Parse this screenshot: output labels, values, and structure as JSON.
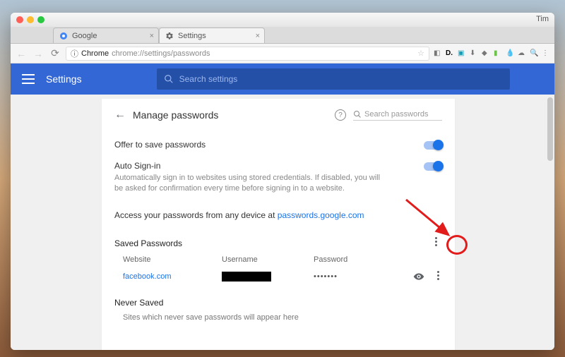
{
  "os": {
    "user": "Tim"
  },
  "browser": {
    "tabs": [
      {
        "title": "Google",
        "active": false
      },
      {
        "title": "Settings",
        "active": true
      }
    ],
    "address": {
      "scheme_label": "Chrome",
      "path": "chrome://settings/passwords"
    }
  },
  "header": {
    "app_title": "Settings",
    "search_placeholder": "Search settings"
  },
  "page": {
    "title": "Manage passwords",
    "search_placeholder": "Search passwords",
    "offer": {
      "title": "Offer to save passwords",
      "enabled": true
    },
    "autosignin": {
      "title": "Auto Sign-in",
      "description": "Automatically sign in to websites using stored credentials. If disabled, you will be asked for confirmation every time before signing in to a website.",
      "enabled": true
    },
    "access_line_prefix": "Access your passwords from any device at ",
    "access_link": "passwords.google.com",
    "saved": {
      "title": "Saved Passwords",
      "columns": {
        "website": "Website",
        "username": "Username",
        "password": "Password"
      },
      "rows": [
        {
          "website": "facebook.com",
          "username": "██████",
          "password_mask": "•••••••"
        }
      ]
    },
    "never": {
      "title": "Never Saved",
      "empty": "Sites which never save passwords will appear here"
    }
  }
}
